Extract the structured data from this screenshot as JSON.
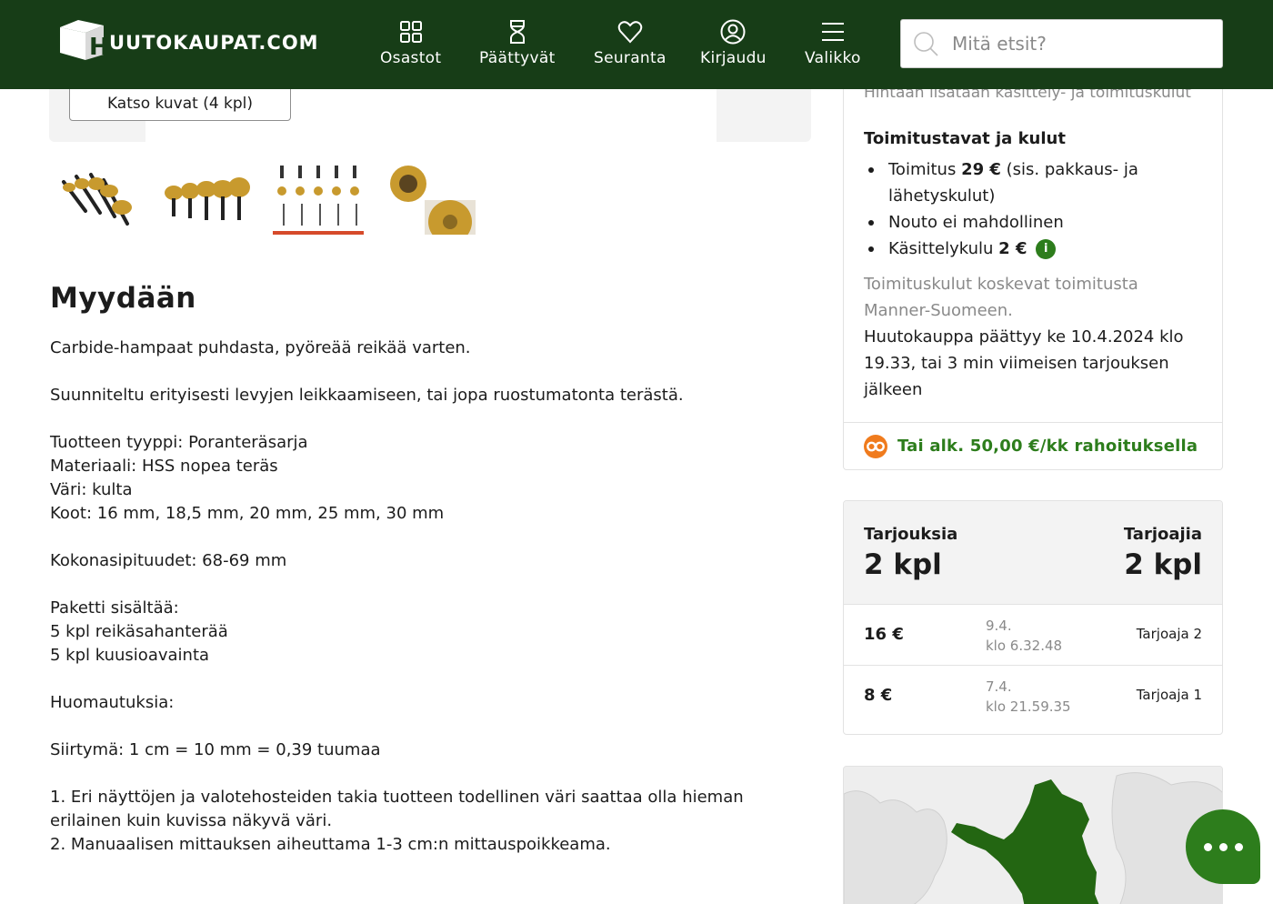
{
  "header": {
    "logo_text": "UUTOKAUPAT.COM",
    "nav": [
      {
        "label": "Osastot",
        "icon": "grid-icon"
      },
      {
        "label": "Päättyvät",
        "icon": "hourglass-icon"
      },
      {
        "label": "Seuranta",
        "icon": "heart-icon"
      },
      {
        "label": "Kirjaudu",
        "icon": "user-icon"
      },
      {
        "label": "Valikko",
        "icon": "menu-icon"
      }
    ],
    "search_placeholder": "Mitä etsit?"
  },
  "gallery": {
    "view_images_label": "Katso kuvat (4 kpl)",
    "active_thumb_index": 2
  },
  "description": {
    "title": "Myydään",
    "lines": [
      "Carbide-hampaat puhdasta, pyöreää reikää varten.",
      "",
      "Suunniteltu erityisesti levyjen leikkaamiseen, tai jopa ruostumatonta terästä.",
      "",
      "Tuotteen tyyppi: Poranteräsarja",
      "Materiaali: HSS nopea teräs",
      "Väri: kulta",
      "Koot: 16 mm, 18,5 mm, 20 mm, 25 mm, 30 mm",
      "",
      "Kokonasipituudet: 68-69 mm",
      "",
      "Paketti sisältää:",
      "5 kpl reikäsahanterää",
      "5 kpl kuusioavainta",
      "",
      "Huomautuksia:",
      "",
      "Siirtymä: 1 cm = 10 mm = 0,39 tuumaa",
      "",
      "1. Eri näyttöjen ja valotehosteiden takia tuotteen todellinen väri saattaa olla hieman erilainen kuin kuvissa näkyvä väri.",
      "2. Manuaalisen mittauksen aiheuttama 1-3 cm:n mittauspoikkeama."
    ]
  },
  "shipping": {
    "faded_top": "Hintaan lisätään käsittely- ja toimituskulut",
    "title": "Toimitustavat ja kulut",
    "item1_prefix": "Toimitus ",
    "item1_amount": "29 €",
    "item1_suffix": " (sis. pakkaus- ja lähetyskulut)",
    "item2": "Nouto ei mahdollinen",
    "item3_prefix": "Käsittelykulu ",
    "item3_amount": "2 €",
    "note": "Toimituskulut koskevat toimitusta Manner-Suomeen.",
    "end_text": "Huutokauppa päättyy ke 10.4.2024 klo 19.33, tai 3 min viimeisen tarjouksen jälkeen",
    "finance_text": "Tai alk. 50,00 €/kk rahoituksella"
  },
  "bids": {
    "offers_label": "Tarjouksia",
    "offers_value": "2 kpl",
    "bidders_label": "Tarjoajia",
    "bidders_value": "2 kpl",
    "rows": [
      {
        "amount": "16 €",
        "date": "9.4.",
        "time": "klo 6.32.48",
        "bidder": "Tarjoaja 2"
      },
      {
        "amount": "8 €",
        "date": "7.4.",
        "time": "klo 21.59.35",
        "bidder": "Tarjoaja 1"
      }
    ]
  },
  "colors": {
    "header_bg": "#173d17",
    "accent_green": "#2d7d1c",
    "active_thumb": "#d64a2a",
    "finance_orange": "#f07b1d"
  }
}
